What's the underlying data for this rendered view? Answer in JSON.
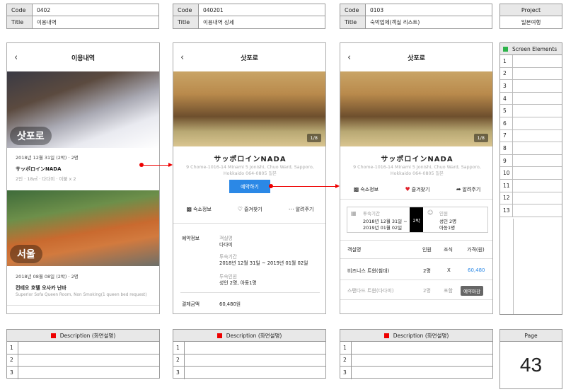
{
  "screens": [
    {
      "code_label": "Code",
      "code": "0402",
      "title_label": "Title",
      "title": "이용내역"
    },
    {
      "code_label": "Code",
      "code": "040201",
      "title_label": "Title",
      "title": "이용내역 상세"
    },
    {
      "code_label": "Code",
      "code": "0103",
      "title_label": "Title",
      "title": "숙박업체(객실 리스트)"
    }
  ],
  "project": {
    "label": "Project",
    "value": "일본여행"
  },
  "phone1": {
    "header": "이용내역",
    "city1": "삿포로",
    "item1_date": "2018년 12월 31일 (2박) · 2명",
    "item1_name": "サッポロインNADA",
    "item1_info": "2인 · 18㎡ · 다다미 · 이불 x 2",
    "city2": "서울",
    "item2_date": "2018년 08월 08일 (2박) · 2명",
    "item2_name": "컨테오 호텔 오사카 난바",
    "item2_info": "Superior Sofa Queen Room, Non Smoking(1 queen bed request)"
  },
  "phone2": {
    "header": "삿포로",
    "photo_count": "1/8",
    "hotel_name": "サッポロインNADA",
    "address_line1": "9 Chome-1016-14 Minami 5 Jonishi, Chuo Ward, Sapporo,",
    "address_line2": "Hokkaido 064-0805 일본",
    "book_button": "예약하기",
    "action_info": "숙소정보",
    "action_fav": "즐겨찾기",
    "action_share": "알려주기",
    "section_label": "예약정보",
    "room_label": "객실명",
    "room_value": "다다미",
    "period_label": "투숙기간",
    "period_value": "2018년 12월 31일 ~ 2019년 01월 02일",
    "guests_label": "투숙인원",
    "guests_value": "성인 2명, 아동1명",
    "pay_label": "결제금액",
    "pay_value": "60,480원"
  },
  "phone3": {
    "header": "삿포로",
    "photo_count": "1/8",
    "hotel_name": "サッポロインNADA",
    "address_line1": "9 Chome-1016-14 Minami 5 Jonishi, Chuo Ward, Sapporo,",
    "address_line2": "Hokkaido 064-0805 일본",
    "action_info": "숙소정보",
    "action_fav": "즐겨찾기",
    "action_share": "알려주기",
    "period_label": "투숙기간",
    "period_line1": "2018년 12월 31일 ~",
    "period_line2": "2019년 01월 02일",
    "nights": "2박",
    "guests_label": "인원",
    "guests_line1": "성인 2명",
    "guests_line2": "아동1명",
    "col_room": "객실명",
    "col_people": "인원",
    "col_breakfast": "조식",
    "col_price": "가격(원)",
    "rows": [
      {
        "room": "비즈니스 트윈(침대)",
        "people": "2명",
        "breakfast": "X",
        "price": "60,480"
      },
      {
        "room": "스탠다드 트윈(다다미)",
        "people": "2명",
        "breakfast": "포함",
        "price": "예약마감"
      }
    ]
  },
  "screen_elements": {
    "title": "Screen Elements",
    "numbers": [
      "1",
      "2",
      "3",
      "4",
      "5",
      "6",
      "7",
      "8",
      "9",
      "10",
      "11",
      "12",
      "13"
    ]
  },
  "description": {
    "title": "Description (화면설명)",
    "numbers": [
      "1",
      "2",
      "3"
    ]
  },
  "page": {
    "label": "Page",
    "number": "43"
  },
  "colors": {
    "accent_blue": "#2b88e6",
    "marker_red": "#e00000",
    "marker_green": "#2db34a",
    "fav_red": "#e0202a"
  }
}
